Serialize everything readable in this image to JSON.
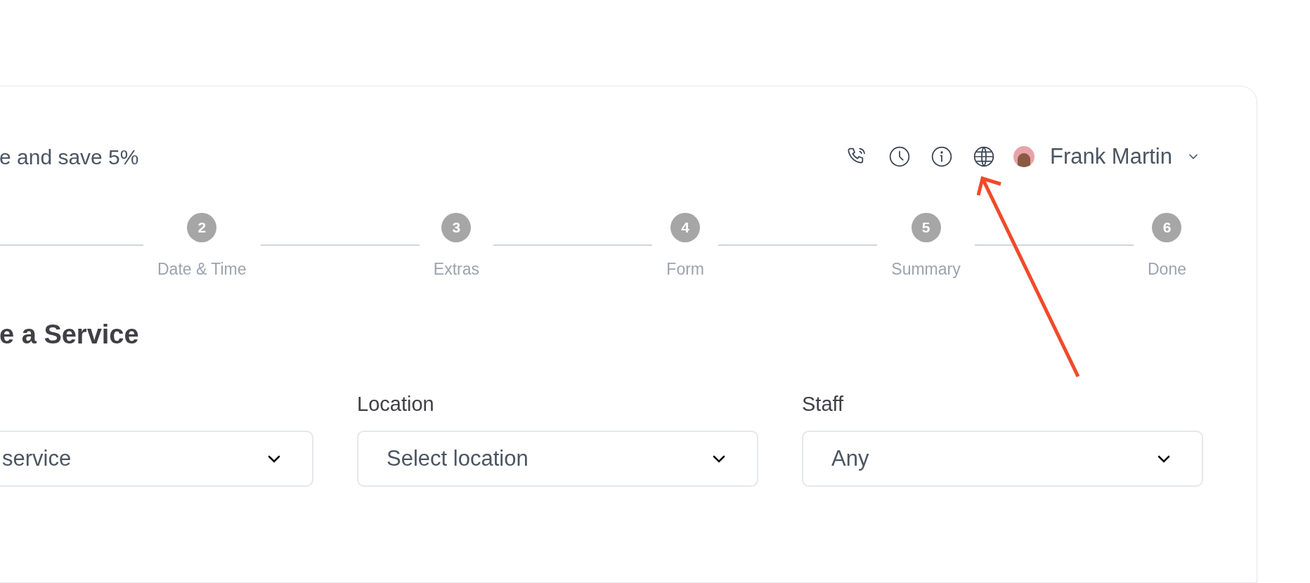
{
  "header": {
    "promo": "e and save 5%",
    "user": {
      "name": "Frank Martin"
    }
  },
  "steps": [
    {
      "number": "2",
      "label": "Date & Time"
    },
    {
      "number": "3",
      "label": "Extras"
    },
    {
      "number": "4",
      "label": "Form"
    },
    {
      "number": "5",
      "label": "Summary"
    },
    {
      "number": "6",
      "label": "Done"
    }
  ],
  "title": "e a Service",
  "fields": [
    {
      "value": "service"
    },
    {
      "label": "Location",
      "value": "Select location"
    },
    {
      "label": "Staff",
      "value": "Any"
    }
  ]
}
